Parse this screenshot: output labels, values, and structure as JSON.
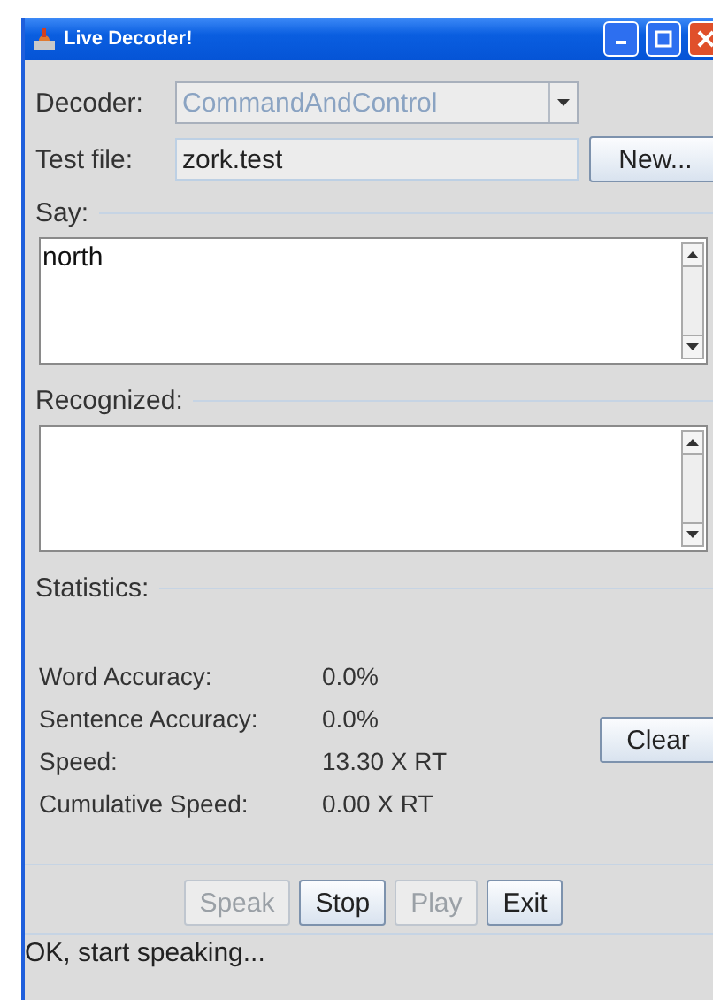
{
  "window": {
    "title": "Live Decoder!"
  },
  "decoder": {
    "label": "Decoder:",
    "value": "CommandAndControl",
    "disabled": true
  },
  "test_file": {
    "label": "Test file:",
    "value": "zork.test",
    "button": "New..."
  },
  "say": {
    "label": "Say:",
    "text": "north"
  },
  "recognized": {
    "label": "Recognized:"
  },
  "statistics": {
    "label": "Statistics:",
    "clear_button": "Clear",
    "rows": [
      {
        "label": "Word Accuracy:",
        "value": "0.0%"
      },
      {
        "label": "Sentence Accuracy:",
        "value": "0.0%"
      },
      {
        "label": "Speed:",
        "value": "13.30 X RT"
      },
      {
        "label": "Cumulative Speed:",
        "value": "0.00 X RT"
      }
    ]
  },
  "buttons": [
    {
      "label": "Speak",
      "disabled": true
    },
    {
      "label": "Stop",
      "disabled": false
    },
    {
      "label": "Play",
      "disabled": true
    },
    {
      "label": "Exit",
      "disabled": false
    }
  ],
  "status_bar": "OK, start speaking..."
}
